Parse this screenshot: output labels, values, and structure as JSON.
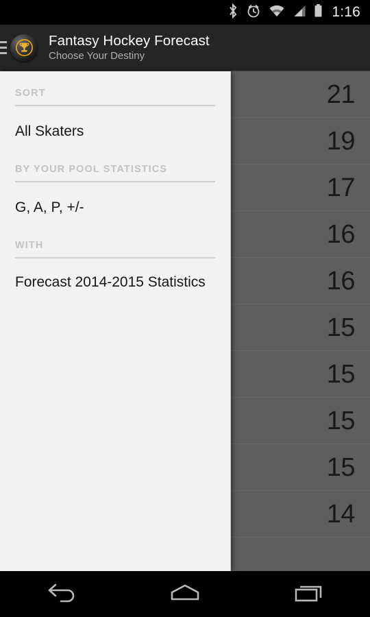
{
  "status_bar": {
    "time": "1:16",
    "icons": [
      "bluetooth-icon",
      "alarm-icon",
      "wifi-icon",
      "cellular-signal-icon",
      "battery-icon"
    ]
  },
  "action_bar": {
    "menu_icon": "hamburger-menu-icon",
    "app_icon": "trophy-icon",
    "title": "Fantasy Hockey Forecast",
    "subtitle": "Choose Your Destiny"
  },
  "drawer": {
    "sections": [
      {
        "header": "SORT",
        "item": "All Skaters"
      },
      {
        "header": "BY YOUR POOL STATISTICS",
        "item": "G, A, P, +/-"
      },
      {
        "header": "WITH",
        "item": "Forecast 2014-2015 Statistics"
      }
    ]
  },
  "content_list": {
    "rows": [
      {
        "value": "21"
      },
      {
        "value": "19"
      },
      {
        "value": "17"
      },
      {
        "value": "16"
      },
      {
        "value": "16"
      },
      {
        "value": "15"
      },
      {
        "value": "15"
      },
      {
        "value": "15"
      },
      {
        "value": "15"
      },
      {
        "value": "14"
      }
    ]
  },
  "nav_bar": {
    "buttons": [
      {
        "name": "back-button",
        "icon": "back-arrow-icon"
      },
      {
        "name": "home-button",
        "icon": "home-icon"
      },
      {
        "name": "recents-button",
        "icon": "recents-icon"
      }
    ]
  },
  "colors": {
    "action_bar_bg": "#252525",
    "drawer_bg": "#f2f2f2",
    "scrim": "#5e5e5e",
    "accent_gold": "#e8a317"
  }
}
